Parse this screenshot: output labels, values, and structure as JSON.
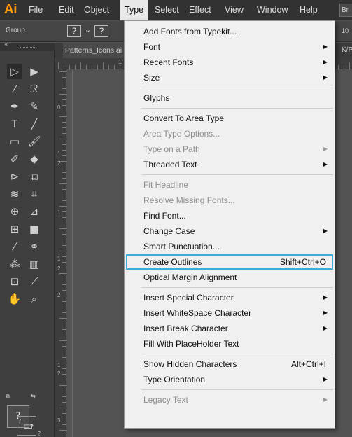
{
  "app": {
    "logo": "Ai",
    "logo_color": "#ff9a00"
  },
  "menubar": {
    "items": [
      {
        "label": "File"
      },
      {
        "label": "Edit"
      },
      {
        "label": "Object"
      },
      {
        "label": "Type",
        "active": true
      },
      {
        "label": "Select"
      },
      {
        "label": "Effect"
      },
      {
        "label": "View"
      },
      {
        "label": "Window"
      },
      {
        "label": "Help"
      }
    ],
    "bridge_label": "Br"
  },
  "controlbar": {
    "group_label": "Group",
    "fill_box": "?",
    "fill_arrow": "⌄",
    "stroke_box": "?",
    "right_value": "10"
  },
  "document": {
    "tab_label": "Patterns_Icons.ai",
    "tab_right_text": "K/P"
  },
  "ruler": {
    "top_labels": [
      "1/"
    ],
    "left_labels": [
      "0",
      "1",
      "2",
      "1",
      "1",
      "2",
      "2",
      "1",
      "2",
      "3"
    ]
  },
  "toolbar": {
    "collapse_icon": "«",
    "tools": [
      {
        "name": "selection-tool-icon",
        "glyph": "▷",
        "selected": true
      },
      {
        "name": "direct-selection-tool-icon",
        "glyph": "▶"
      },
      {
        "name": "magic-wand-tool-icon",
        "glyph": "⁄"
      },
      {
        "name": "lasso-tool-icon",
        "glyph": "ℛ"
      },
      {
        "name": "pen-tool-icon",
        "glyph": "✒"
      },
      {
        "name": "curvature-tool-icon",
        "glyph": "✎"
      },
      {
        "name": "type-tool-icon",
        "glyph": "T"
      },
      {
        "name": "line-segment-tool-icon",
        "glyph": "╱"
      },
      {
        "name": "rectangle-tool-icon",
        "glyph": "▭"
      },
      {
        "name": "paintbrush-tool-icon",
        "glyph": "🖌"
      },
      {
        "name": "shaper-tool-icon",
        "glyph": "✐"
      },
      {
        "name": "eraser-tool-icon",
        "glyph": "◆"
      },
      {
        "name": "rotate-tool-icon",
        "glyph": "⊳"
      },
      {
        "name": "scale-tool-icon",
        "glyph": "⧉"
      },
      {
        "name": "width-tool-icon",
        "glyph": "≋"
      },
      {
        "name": "free-transform-tool-icon",
        "glyph": "⌗"
      },
      {
        "name": "shape-builder-tool-icon",
        "glyph": "⊕"
      },
      {
        "name": "perspective-grid-tool-icon",
        "glyph": "⊿"
      },
      {
        "name": "mesh-tool-icon",
        "glyph": "⊞"
      },
      {
        "name": "gradient-tool-icon",
        "glyph": "■"
      },
      {
        "name": "eyedropper-tool-icon",
        "glyph": "⁄"
      },
      {
        "name": "blend-tool-icon",
        "glyph": "⚭"
      },
      {
        "name": "symbol-sprayer-tool-icon",
        "glyph": "⁂"
      },
      {
        "name": "column-graph-tool-icon",
        "glyph": "▥"
      },
      {
        "name": "artboard-tool-icon",
        "glyph": "⊡"
      },
      {
        "name": "slice-tool-icon",
        "glyph": "⟋"
      },
      {
        "name": "hand-tool-icon",
        "glyph": "✋"
      },
      {
        "name": "zoom-tool-icon",
        "glyph": "⌕"
      }
    ],
    "fill_label": "?",
    "stroke_label": "?",
    "mini_default": "⧉",
    "mini_swap": "⇆",
    "color_mode_labels": [
      "?",
      "?"
    ],
    "swatch_colors": [
      "#ffffff",
      "#1a1a1a",
      "#ff0000"
    ],
    "screen_mode_icon": "▭"
  },
  "type_menu": {
    "items": [
      {
        "label": "Add Fonts from Typekit...",
        "enabled": true
      },
      {
        "label": "Font",
        "enabled": true,
        "submenu": true
      },
      {
        "label": "Recent Fonts",
        "enabled": true,
        "submenu": true
      },
      {
        "label": "Size",
        "enabled": true,
        "submenu": true
      },
      {
        "separator": true
      },
      {
        "label": "Glyphs",
        "enabled": true
      },
      {
        "separator": true
      },
      {
        "label": "Convert To Area Type",
        "enabled": true
      },
      {
        "label": "Area Type Options...",
        "enabled": false
      },
      {
        "label": "Type on a Path",
        "enabled": false,
        "submenu": true
      },
      {
        "label": "Threaded Text",
        "enabled": true,
        "submenu": true
      },
      {
        "separator": true
      },
      {
        "label": "Fit Headline",
        "enabled": false
      },
      {
        "label": "Resolve Missing Fonts...",
        "enabled": false
      },
      {
        "label": "Find Font...",
        "enabled": true
      },
      {
        "label": "Change Case",
        "enabled": true,
        "submenu": true
      },
      {
        "label": "Smart Punctuation...",
        "enabled": true
      },
      {
        "label": "Create Outlines",
        "enabled": true,
        "shortcut": "Shift+Ctrl+O",
        "highlighted": true
      },
      {
        "label": "Optical Margin Alignment",
        "enabled": true
      },
      {
        "separator": true
      },
      {
        "label": "Insert Special Character",
        "enabled": true,
        "submenu": true
      },
      {
        "label": "Insert WhiteSpace Character",
        "enabled": true,
        "submenu": true
      },
      {
        "label": "Insert Break Character",
        "enabled": true,
        "submenu": true
      },
      {
        "label": "Fill With PlaceHolder Text",
        "enabled": true
      },
      {
        "separator": true
      },
      {
        "label": "Show Hidden Characters",
        "enabled": true,
        "shortcut": "Alt+Ctrl+I"
      },
      {
        "label": "Type Orientation",
        "enabled": true,
        "submenu": true
      },
      {
        "separator": true
      },
      {
        "label": "Legacy Text",
        "enabled": false,
        "submenu": true
      }
    ],
    "submenu_arrow": "▶",
    "highlight_color": "#3aaed8"
  }
}
